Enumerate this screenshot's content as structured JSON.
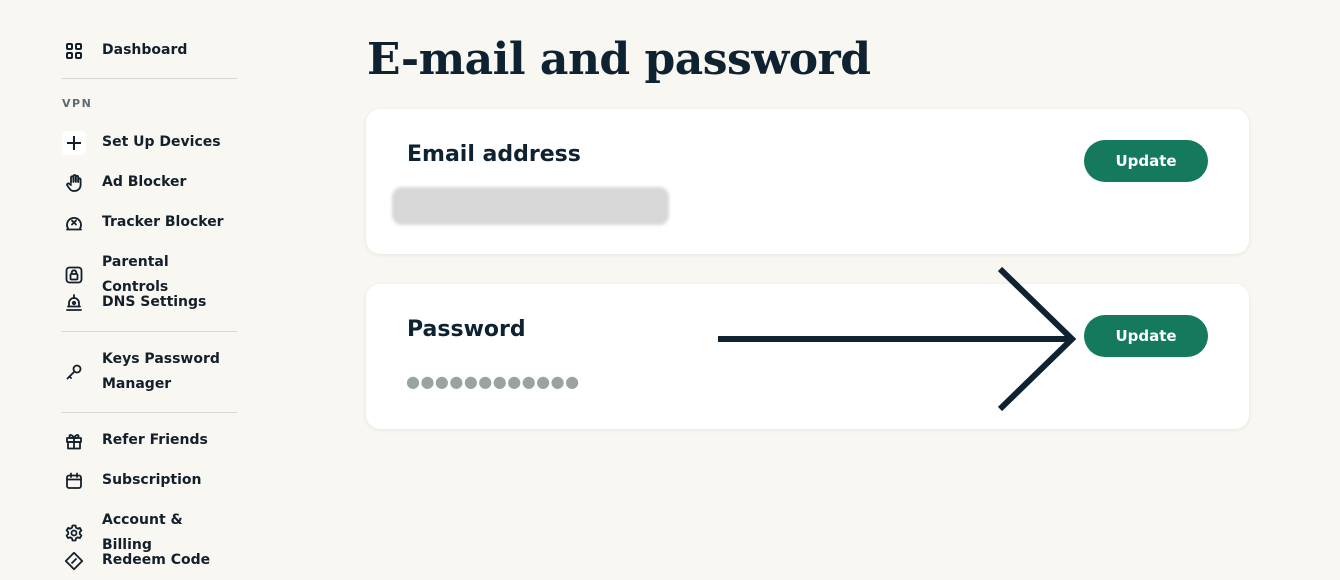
{
  "sidebar": {
    "top_items": [
      {
        "label": "Dashboard",
        "icon": "grid-icon"
      }
    ],
    "section_label": "VPN",
    "vpn_items": [
      {
        "label": "Set Up Devices",
        "icon": "plus-icon"
      },
      {
        "label": "Ad Blocker",
        "icon": "hand-icon"
      },
      {
        "label": "Tracker Blocker",
        "icon": "tracker-block-icon"
      },
      {
        "label": "Parental Controls",
        "icon": "lock-icon"
      },
      {
        "label": "DNS Settings",
        "icon": "dns-icon"
      }
    ],
    "keys_item": {
      "label": "Keys Password Manager",
      "icon": "key-icon"
    },
    "account_items": [
      {
        "label": "Refer Friends",
        "icon": "gift-icon"
      },
      {
        "label": "Subscription",
        "icon": "calendar-icon"
      },
      {
        "label": "Account & Billing",
        "icon": "gear-icon"
      },
      {
        "label": "Redeem Code",
        "icon": "ticket-icon"
      }
    ]
  },
  "main": {
    "title": "E-mail and password",
    "email_card": {
      "title": "Email address",
      "button": "Update"
    },
    "password_card": {
      "title": "Password",
      "masked_value": "●●●●●●●●●●●●",
      "button": "Update"
    }
  },
  "colors": {
    "background": "#f8f7f1",
    "accent": "#14795d",
    "text": "#0e2231",
    "arrow": "#0e2231"
  }
}
